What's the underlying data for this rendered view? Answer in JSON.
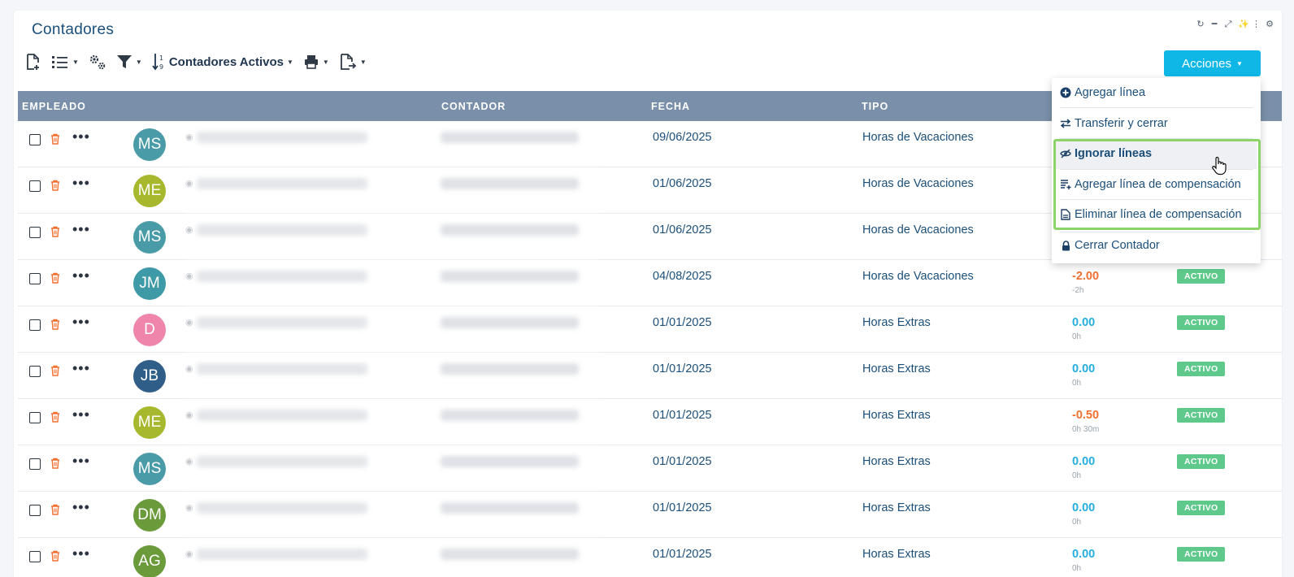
{
  "panel": {
    "title": "Contadores",
    "window_tools": [
      "refresh-icon",
      "minimize-icon",
      "expand-icon",
      "magic-icon",
      "more-vertical-icon",
      "gear-icon"
    ]
  },
  "toolbar": {
    "sort_label": "Contadores Activos",
    "acciones_label": "Acciones"
  },
  "table": {
    "headers": {
      "empleado": "EMPLEADO",
      "contador": "CONTADOR",
      "fecha": "FECHA",
      "tipo": "TIPO"
    },
    "rows": [
      {
        "initials": "MS",
        "color": "#4a9ba8",
        "fecha": "09/06/2025",
        "tipo": "Horas de Vacaciones",
        "valor": "",
        "sub": "",
        "estado": ""
      },
      {
        "initials": "ME",
        "color": "#a8b82e",
        "fecha": "01/06/2025",
        "tipo": "Horas de Vacaciones",
        "valor": "",
        "sub": "",
        "estado": ""
      },
      {
        "initials": "MS",
        "color": "#4a9ba8",
        "fecha": "01/06/2025",
        "tipo": "Horas de Vacaciones",
        "valor": "",
        "sub": "",
        "estado": ""
      },
      {
        "initials": "JM",
        "color": "#3f9aa8",
        "fecha": "04/08/2025",
        "tipo": "Horas de Vacaciones",
        "valor": "-2.00",
        "sub": "-2h",
        "estado": "ACTIVO"
      },
      {
        "initials": "D",
        "color": "#ef85ab",
        "fecha": "01/01/2025",
        "tipo": "Horas Extras",
        "valor": "0.00",
        "sub": "0h",
        "estado": "ACTIVO"
      },
      {
        "initials": "JB",
        "color": "#2f5f88",
        "fecha": "01/01/2025",
        "tipo": "Horas Extras",
        "valor": "0.00",
        "sub": "0h",
        "estado": "ACTIVO"
      },
      {
        "initials": "ME",
        "color": "#a8b82e",
        "fecha": "01/01/2025",
        "tipo": "Horas Extras",
        "valor": "-0.50",
        "sub": "0h 30m",
        "estado": "ACTIVO"
      },
      {
        "initials": "MS",
        "color": "#4a9ba8",
        "fecha": "01/01/2025",
        "tipo": "Horas Extras",
        "valor": "0.00",
        "sub": "0h",
        "estado": "ACTIVO"
      },
      {
        "initials": "DM",
        "color": "#6a9a3a",
        "fecha": "01/01/2025",
        "tipo": "Horas Extras",
        "valor": "0.00",
        "sub": "0h",
        "estado": "ACTIVO"
      },
      {
        "initials": "AG",
        "color": "#6a9a3a",
        "fecha": "01/01/2025",
        "tipo": "Horas Extras",
        "valor": "0.00",
        "sub": "0h",
        "estado": "ACTIVO"
      }
    ]
  },
  "menu": {
    "items": [
      {
        "label": "Agregar línea",
        "icon": "plus-circle-icon"
      },
      {
        "label": "Transferir y cerrar",
        "icon": "transfer-icon"
      },
      {
        "label": "Ignorar líneas",
        "icon": "eye-slash-icon"
      },
      {
        "label": "Agregar línea de compensación",
        "icon": "list-add-icon"
      },
      {
        "label": "Eliminar línea de compensación",
        "icon": "document-icon"
      },
      {
        "label": "Cerrar Contador",
        "icon": "lock-icon"
      }
    ]
  }
}
